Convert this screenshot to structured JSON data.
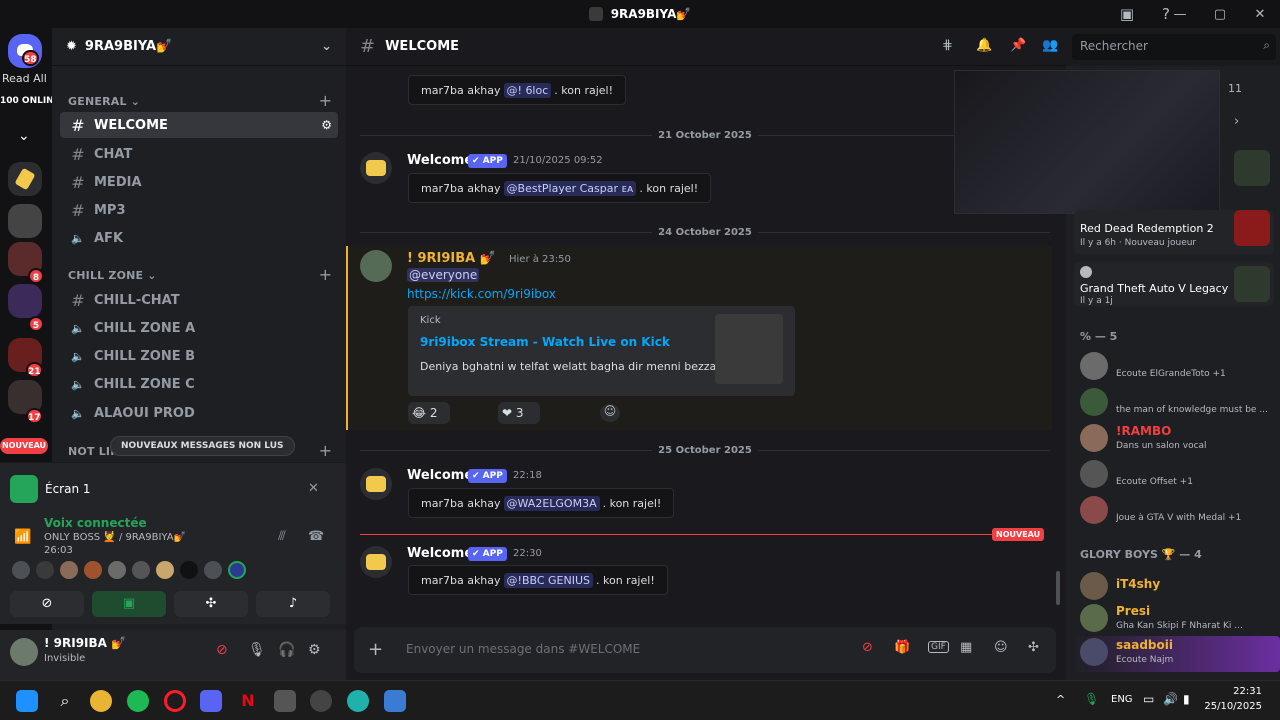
{
  "window": {
    "title": "9RA9BIYA💅",
    "min": "—",
    "max": "▢",
    "close": "✕"
  },
  "rail": {
    "dm_badge": "58",
    "read_all": "Read All",
    "online": "100 ONLINE",
    "badges": [
      "8",
      "5",
      "21",
      "17"
    ],
    "nouveau": "NOUVEAU"
  },
  "server": {
    "name": "9RA9BIYA💅"
  },
  "categories": {
    "general": "GENERAL",
    "chill": "CHILL ZONE",
    "notlike": "NOT LIK"
  },
  "channels": {
    "general": [
      {
        "name": "WELCOME",
        "icon": "#"
      },
      {
        "name": "CHAT",
        "icon": "#"
      },
      {
        "name": "MEDIA",
        "icon": "#"
      },
      {
        "name": "MP3",
        "icon": "#"
      },
      {
        "name": "AFK",
        "icon": "🔈"
      }
    ],
    "chill": [
      {
        "name": "CHILL-CHAT",
        "icon": "#"
      },
      {
        "name": "CHILL ZONE A",
        "icon": "🔈"
      },
      {
        "name": "CHILL ZONE B",
        "icon": "🔈"
      },
      {
        "name": "CHILL ZONE C",
        "icon": "🔈"
      },
      {
        "name": "ALAOUI PROD",
        "icon": "🔈"
      }
    ]
  },
  "new_messages_pill": "NOUVEAUX MESSAGES NON LUS",
  "voice": {
    "screen": "Écran 1",
    "connected": "Voix connectée",
    "channel": "ONLY BOSS 💆 / 9RA9BIYA💅",
    "timer": "26:03"
  },
  "user": {
    "name": "! 9RI9IBA 💅",
    "status": "Invisible"
  },
  "chat": {
    "channel": "WELCOME",
    "search_placeholder": "Rechercher",
    "composer_placeholder": "Envoyer un message dans #WELCOME",
    "messages": [
      {
        "pre": "mar7ba akhay",
        "mention": "@! 6loc",
        "post": ". kon rajel!"
      },
      {
        "date": "21 October 2025"
      },
      {
        "author": "Welcomer",
        "tag": "✔ APP",
        "time": "21/10/2025 09:52",
        "pre": "mar7ba akhay",
        "mention": "@BestPlayer Caspar ᴇᴀ",
        "post": ". kon rajel!"
      },
      {
        "date": "24 October 2025"
      },
      {
        "author": "! 9RI9IBA 💅",
        "time": "Hier à 23:50",
        "everyone": "@everyone",
        "link": "https://kick.com/9ri9ibox",
        "embed_site": "Kick",
        "embed_title": "9ri9ibox Stream - Watch Live on Kick",
        "embed_desc": "Deniya bghatni w telfat welatt bagha dir menni bezzaf...",
        "react1": "2",
        "react2": "3"
      },
      {
        "date": "25 October 2025"
      },
      {
        "author": "Welcomer",
        "tag": "✔ APP",
        "time": "22:18",
        "pre": "mar7ba akhay",
        "mention": "@WA2ELGOM3A",
        "post": ". kon rajel!"
      },
      {
        "new": "NOUVEAU"
      },
      {
        "author": "Welcomer",
        "tag": "✔ APP",
        "time": "22:30",
        "pre": "mar7ba akhay",
        "mention": "@!BBC GENIUS",
        "post": ". kon rajel!"
      }
    ]
  },
  "members": {
    "preview_count": "11",
    "activities": [
      {
        "game": "Red Dead Redemption 2",
        "sub": "Il y a 6h · Nouveau joueur"
      },
      {
        "game": "Grand Theft Auto V Legacy",
        "sub": "Il y a 1j"
      }
    ],
    "group1": "% — 5",
    "group1_rows": [
      {
        "name": "",
        "status": "Écoute ElGrandeToto +1"
      },
      {
        "name": "",
        "status": "the man of knowledge must be ..."
      },
      {
        "name": "!RAMBO",
        "status": "Dans un salon vocal"
      },
      {
        "name": "",
        "status": "Écoute Offset +1"
      },
      {
        "name": "",
        "status": "Joue à GTA V with Medal +1"
      }
    ],
    "group2": "GLORY BOYS 🏆 — 4",
    "group2_rows": [
      {
        "name": "iT4shy",
        "status": ""
      },
      {
        "name": "Presi",
        "status": "Gha Kan Skipi F Nharat Ki ..."
      },
      {
        "name": "saadboii",
        "status": "Écoute Najm"
      }
    ]
  },
  "taskbar": {
    "lang": "ENG",
    "time": "22:31",
    "date": "25/10/2025"
  }
}
